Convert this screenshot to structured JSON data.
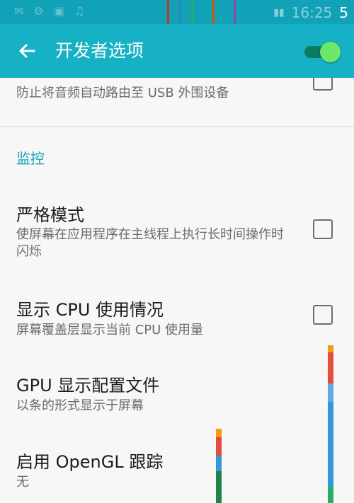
{
  "status_bar": {
    "time": "16:25",
    "signal_badge": "5"
  },
  "app_bar": {
    "back_icon": "arrow-left-icon",
    "title": "开发者选项",
    "master_toggle_on": true
  },
  "list": {
    "partial_item": {
      "subtitle": "防止将音频自动路由至 USB 外围设备",
      "checked": false
    },
    "section_header": "监控",
    "items": [
      {
        "title": "严格模式",
        "subtitle": "使屏幕在应用程序在主线程上执行长时间操作时闪烁",
        "checked": false,
        "has_checkbox": true
      },
      {
        "title": "显示 CPU 使用情况",
        "subtitle": "屏幕覆盖层显示当前 CPU 使用量",
        "checked": false,
        "has_checkbox": true
      },
      {
        "title": "GPU 显示配置文件",
        "subtitle": "以条的形式显示于屏幕",
        "has_checkbox": false
      },
      {
        "title": "启用 OpenGL 跟踪",
        "subtitle": "无",
        "has_checkbox": false
      }
    ]
  },
  "colors": {
    "status_bar": "#12a2b7",
    "app_bar": "#16b1c4",
    "accent": "#15a4b4",
    "toggle_thumb": "#6de66a",
    "toggle_track": "#0e7a63"
  }
}
